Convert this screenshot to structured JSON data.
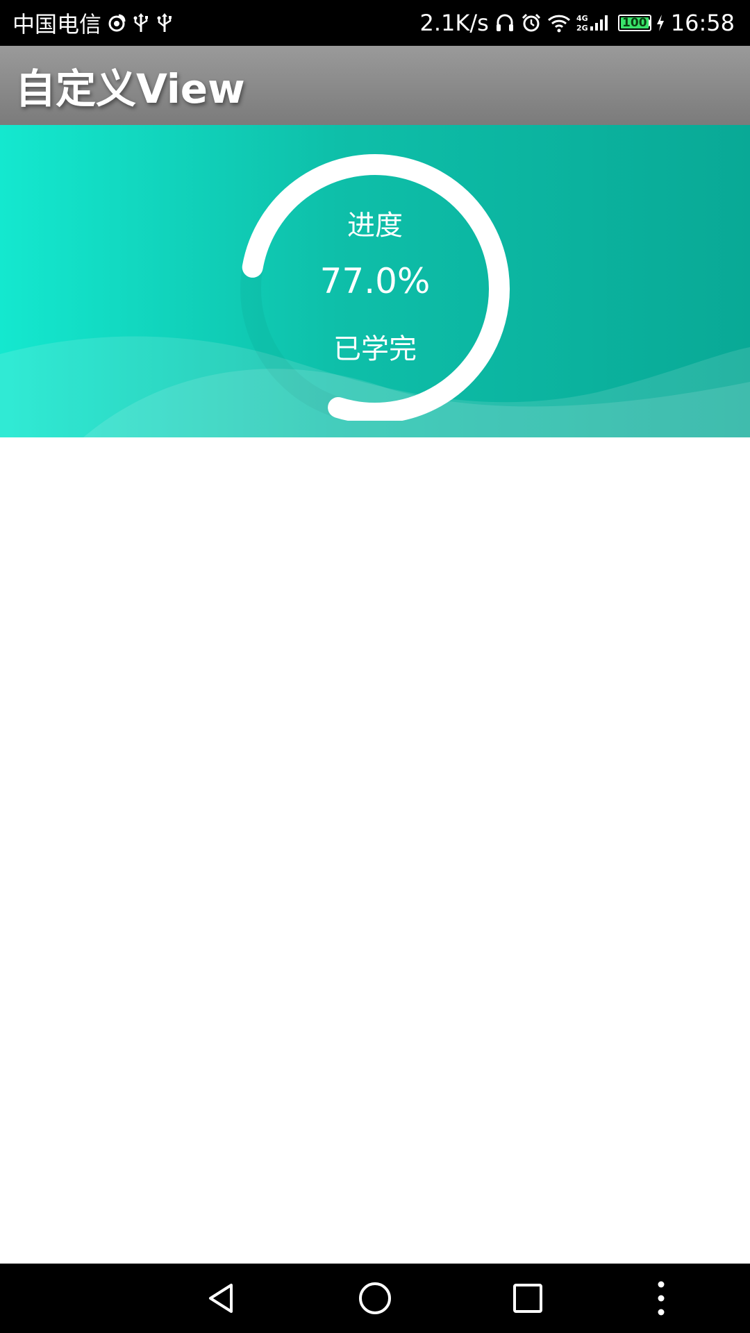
{
  "status_bar": {
    "carrier": "中国电信",
    "net_speed": "2.1K/s",
    "signal_type": "4G/2G",
    "battery": "100",
    "time": "16:58",
    "left_icons": [
      "weibo-icon",
      "usb-icon",
      "usb-icon"
    ],
    "right_icons": [
      "headphones-icon",
      "alarm-icon",
      "wifi-icon",
      "signal-icon",
      "battery-icon",
      "charging-icon"
    ]
  },
  "app_bar": {
    "title": "自定义View"
  },
  "progress_card": {
    "label": "进度",
    "value_text": "77.0%",
    "sub_label": "已学完",
    "progress": 0.77,
    "colors": {
      "gradient_start": "#14e8cf",
      "gradient_end": "#09a996",
      "ring": "#ffffff"
    }
  },
  "nav_bar": {
    "buttons": [
      "back-icon",
      "home-icon",
      "recents-icon",
      "menu-icon"
    ]
  }
}
